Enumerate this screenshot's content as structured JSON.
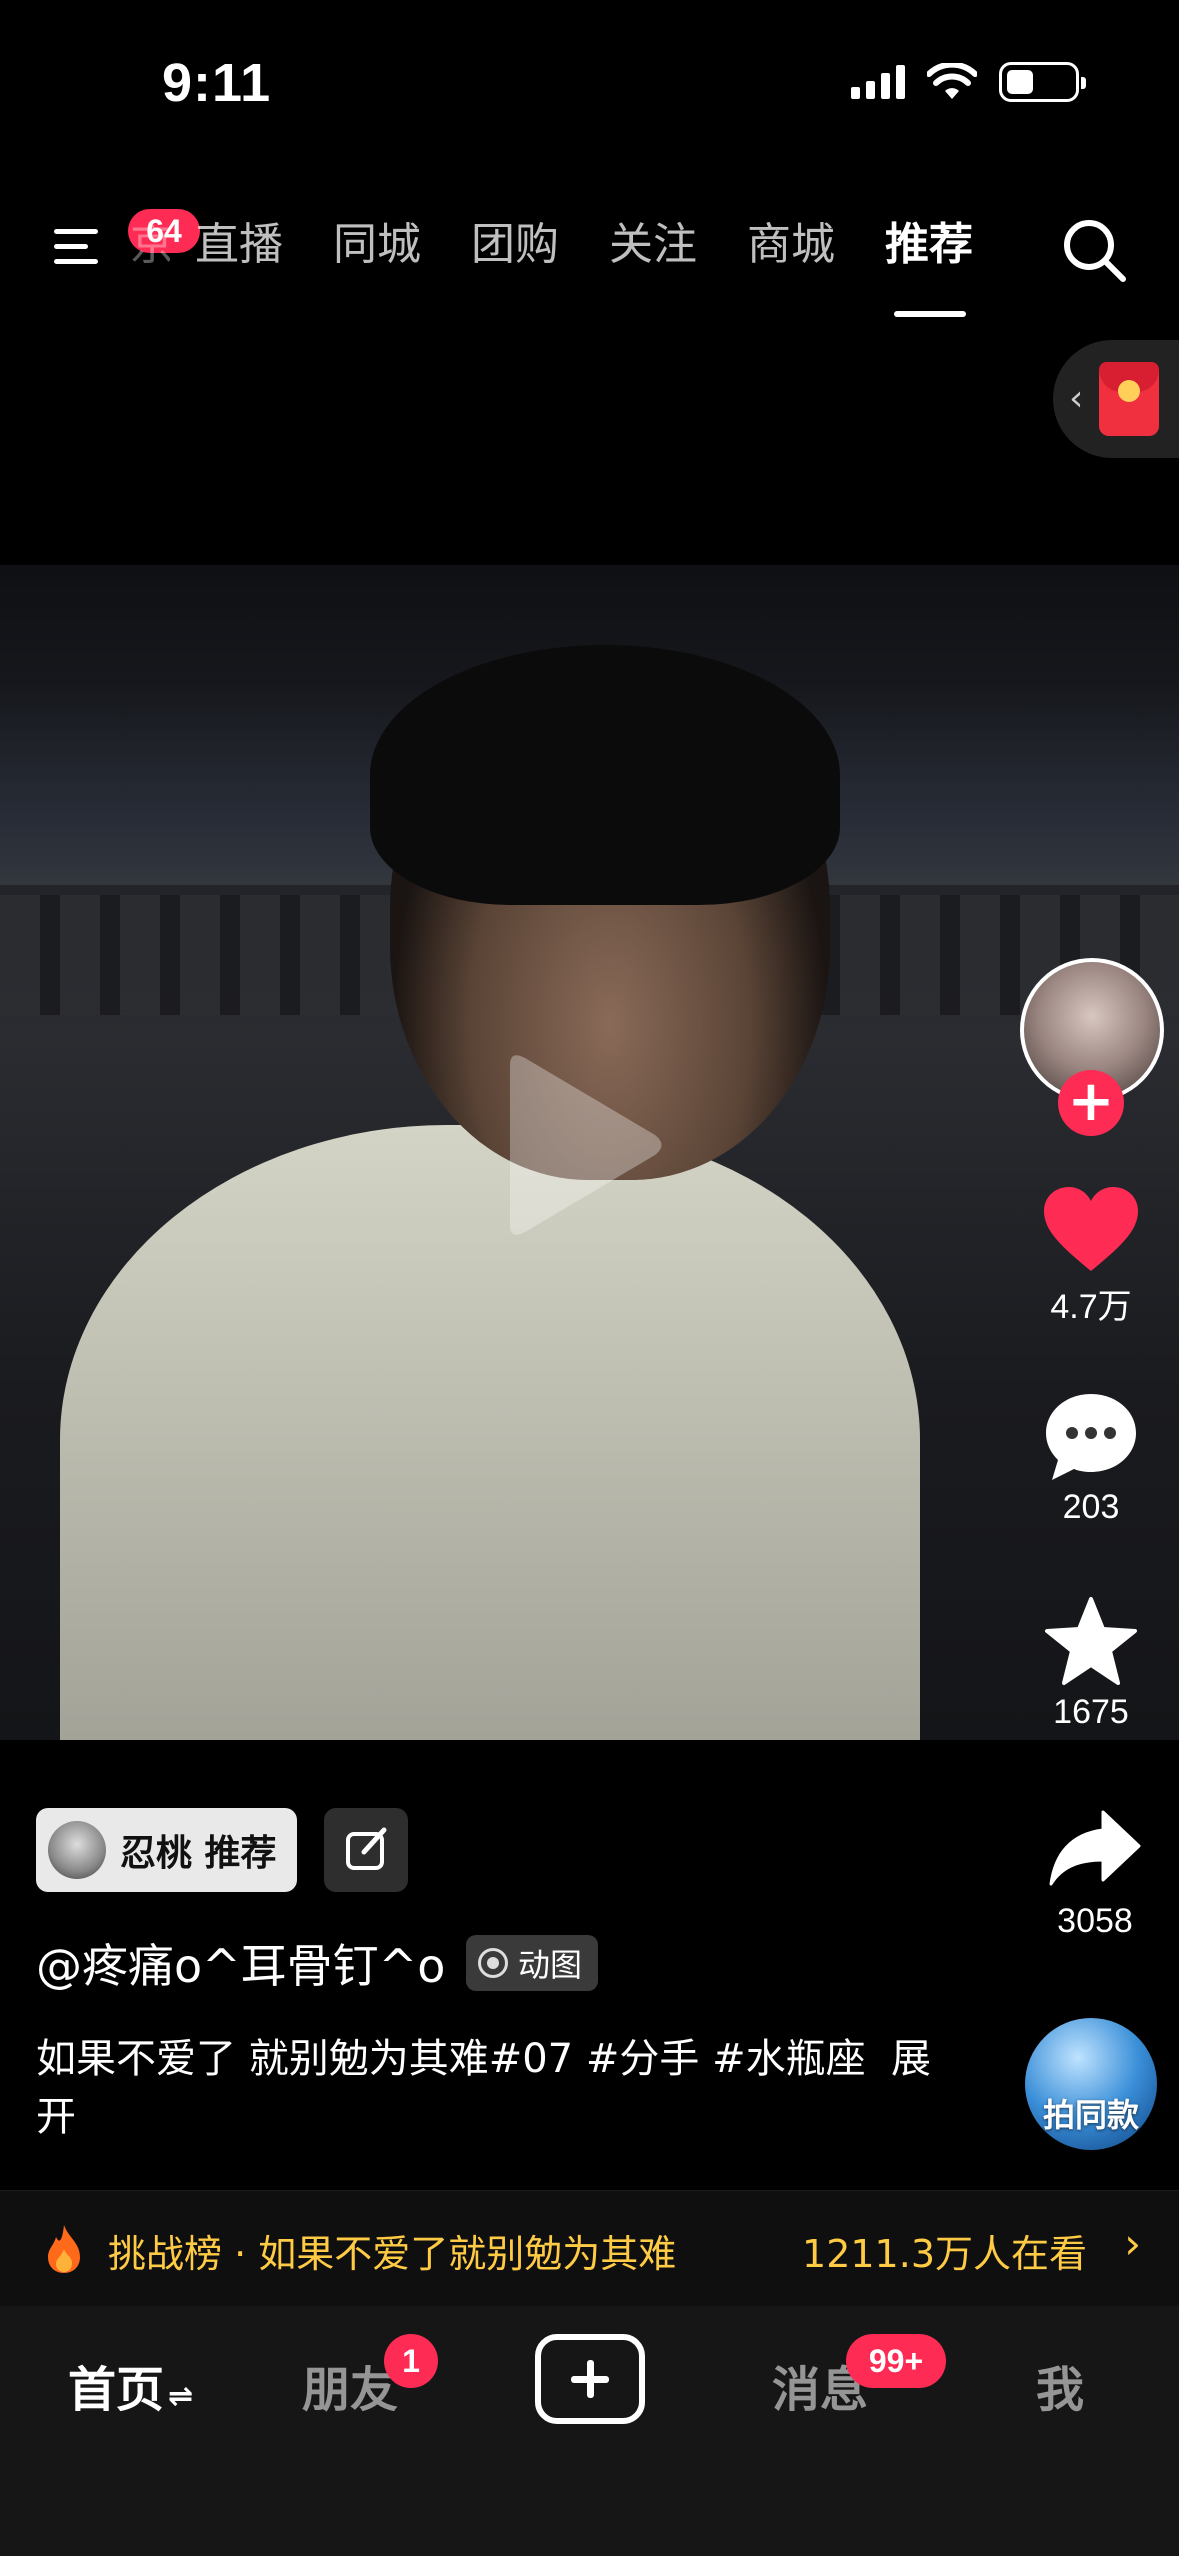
{
  "status_bar": {
    "time": "9:11"
  },
  "top_nav": {
    "menu_badge": "64",
    "faded_tab": "京",
    "tabs": [
      "直播",
      "同城",
      "团购",
      "关注",
      "商城",
      "推荐"
    ],
    "active_tab": "推荐"
  },
  "video": {
    "creator_avatar": "avatar-girl",
    "likes": "4.7万",
    "comments": "203",
    "favorites": "1675",
    "shares": "3058",
    "make_same_label": "拍同款"
  },
  "info": {
    "source_tag": "忍桃 推荐",
    "author": "@疼痛o^耳骨钉^o",
    "motion_badge": "动图",
    "caption": "如果不爱了 就别勉为其难#07 #分手 #水瓶座",
    "expand_label": "展开"
  },
  "challenge": {
    "text": "挑战榜 · 如果不爱了就别勉为其难",
    "viewers": "1211.3万人在看"
  },
  "tab_bar": {
    "home": "首页",
    "friends": "朋友",
    "friends_badge": "1",
    "messages": "消息",
    "messages_badge": "99+",
    "me": "我"
  },
  "colors": {
    "accent": "#fe2c55",
    "challenge": "#ffcb45"
  }
}
